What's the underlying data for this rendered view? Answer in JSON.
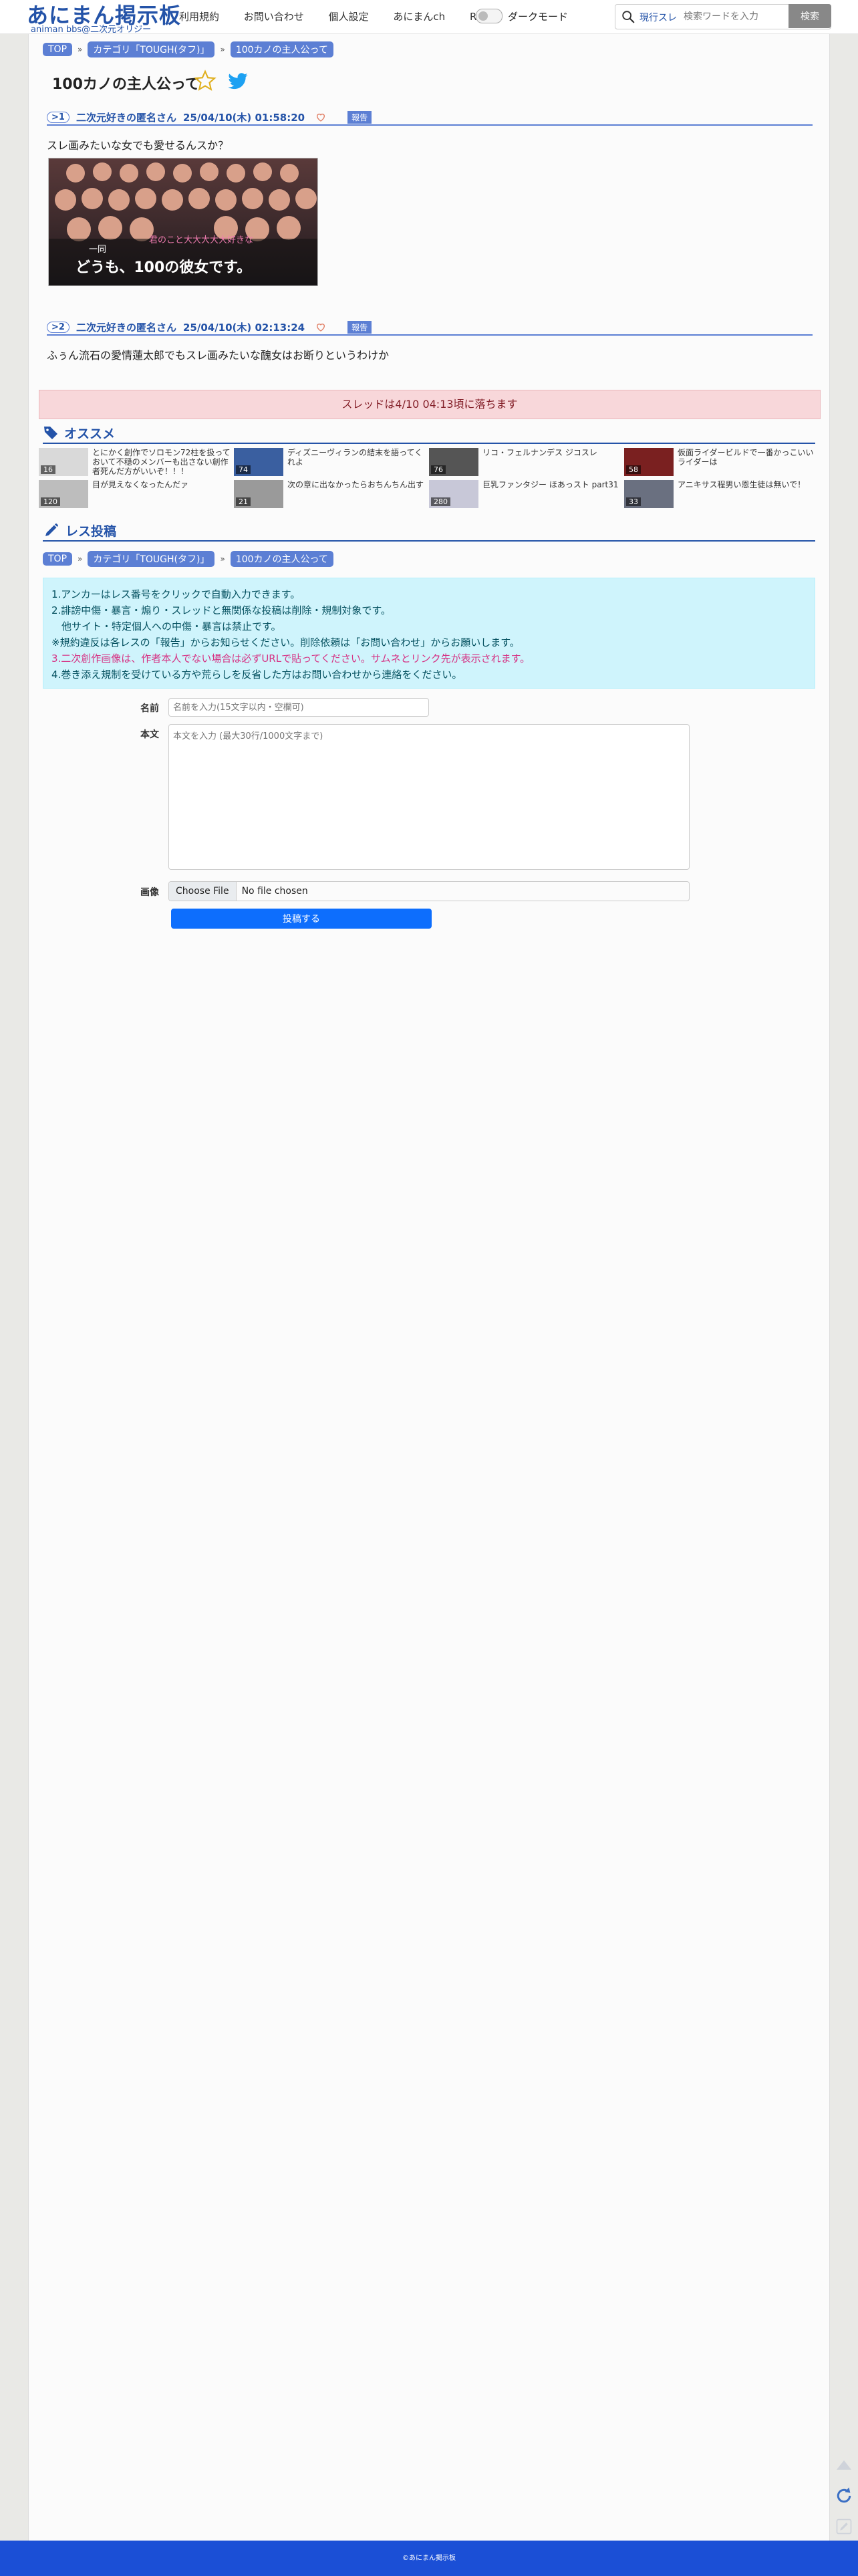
{
  "header": {
    "logo_title": "あにまん掲示板",
    "logo_sub": "animan bbs@二次元オリジー",
    "nav": [
      "利用規約",
      "お問い合わせ",
      "個人設定",
      "あにまんch",
      "RSS"
    ],
    "dark_mode_label": "ダークモード",
    "search_scope": "現行スレ",
    "search_placeholder": "検索ワードを入力",
    "search_button": "検索"
  },
  "breadcrumb": [
    "TOP",
    "カテゴリ「TOUGH(タフ)」",
    "100カノの主人公って"
  ],
  "thread_title": "100カノの主人公って",
  "posts": [
    {
      "no": ">1",
      "name": "二次元好きの匿名さん",
      "date": "25/04/10(木) 01:58:20",
      "report": "報告",
      "body": "スレ画みたいな女でも愛せるんスか？",
      "image_caption_1": "一同",
      "image_caption_2": "どうも、100の彼女です。",
      "image_caption_3": "君のこと大大大大大好きな"
    },
    {
      "no": ">2",
      "name": "二次元好きの匿名さん",
      "date": "25/04/10(木) 02:13:24",
      "report": "報告",
      "body": "ふぅん流石の愛情蓮太郎でもスレ画みたいな醜女はお断りというわけか"
    }
  ],
  "fall_notice": "スレッドは4/10 04:13頃に落ちます",
  "recommend": {
    "heading": "オススメ",
    "items": [
      {
        "title": "とにかく創作でソロモン72柱を扱っておいて不穏のメンバーも出さない創作者死んだ方がいいぞ！！！",
        "count": "16"
      },
      {
        "title": "ディズニーヴィランの結末を語ってくれよ",
        "count": "74"
      },
      {
        "title": "リコ・フェルナンデス ジコスレ",
        "count": "76"
      },
      {
        "title": "仮面ライダービルドで一番かっこいいライダーは",
        "count": "58"
      },
      {
        "title": "目が見えなくなったんだァ",
        "count": "120"
      },
      {
        "title": "次の章に出なかったらおちんちん出す",
        "count": "21"
      },
      {
        "title": "巨乳ファンタジー ほあっスト part31",
        "count": "280"
      },
      {
        "title": "アニキサス程男い恩生徒は無いで！",
        "count": "33"
      }
    ]
  },
  "reply": {
    "heading": "レス投稿",
    "rules": [
      "1.アンカーはレス番号をクリックで自動入力できます。",
      "2.誹謗中傷・暴言・煽り・スレッドと無関係な投稿は削除・規制対象です。",
      "　他サイト・特定個人への中傷・暴言は禁止です。",
      "※規約違反は各レスの「報告」からお知らせください。削除依頼は「お問い合わせ」からお願いします。",
      "3.二次創作画像は、作者本人でない場合は必ずURLで貼ってください。サムネとリンク先が表示されます。",
      "4.巻き添え規制を受けている方や荒らしを反省した方はお問い合わせから連絡をください。"
    ],
    "name_label": "名前",
    "name_placeholder": "名前を入力(15文字以内・空欄可)",
    "body_label": "本文",
    "body_placeholder": "本文を入力 (最大30行/1000文字まで)",
    "image_label": "画像",
    "file_button": "Choose File",
    "file_status": "No file chosen",
    "submit": "投稿する"
  },
  "footer": "©あにまん掲示板",
  "colors": {
    "accent": "#2453a8",
    "pill": "#5c7fd4",
    "footer": "#1b4fd6",
    "notice_bg": "#f8d7da",
    "info_bg": "#cff4fc"
  }
}
